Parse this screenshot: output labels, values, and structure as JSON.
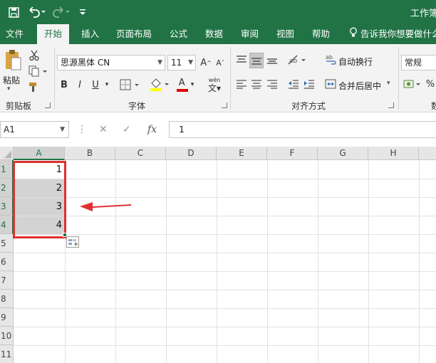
{
  "titlebar": {
    "window_title": "工作簿",
    "quick_access": [
      "save-icon",
      "undo-icon",
      "redo-icon",
      "customize-icon"
    ]
  },
  "tabs": [
    "文件",
    "开始",
    "插入",
    "页面布局",
    "公式",
    "数据",
    "审阅",
    "视图",
    "帮助"
  ],
  "active_tab": "开始",
  "tell_me": "告诉我你想要做什么",
  "ribbon": {
    "clipboard": {
      "paste_label": "粘贴",
      "group_label": "剪贴板"
    },
    "font": {
      "font_name": "思源黑体 CN",
      "font_size": "11",
      "bold": "B",
      "italic": "I",
      "underline": "U",
      "font_color_letter": "A",
      "grow": "A",
      "shrink": "A",
      "wen": "wén",
      "group_label": "字体"
    },
    "alignment": {
      "wrap_text": "自动换行",
      "merge_center": "合并后居中",
      "group_label": "对齐方式"
    },
    "number": {
      "format": "常规",
      "percent": "%",
      "group_label": "数"
    }
  },
  "formula_bar": {
    "name_box": "A1",
    "fx": "fx",
    "value": "1"
  },
  "grid": {
    "columns": [
      "A",
      "B",
      "C",
      "D",
      "E",
      "F",
      "G",
      "H"
    ],
    "rows": [
      "1",
      "2",
      "3",
      "4",
      "5",
      "6",
      "7",
      "8",
      "9",
      "10",
      "11"
    ],
    "cells_A": [
      "1",
      "2",
      "3",
      "4"
    ]
  },
  "colors": {
    "excel_green": "#217346",
    "selection_red": "#e03030",
    "arrow_red": "#e03030",
    "selected_fill": "#d3d3d3"
  }
}
